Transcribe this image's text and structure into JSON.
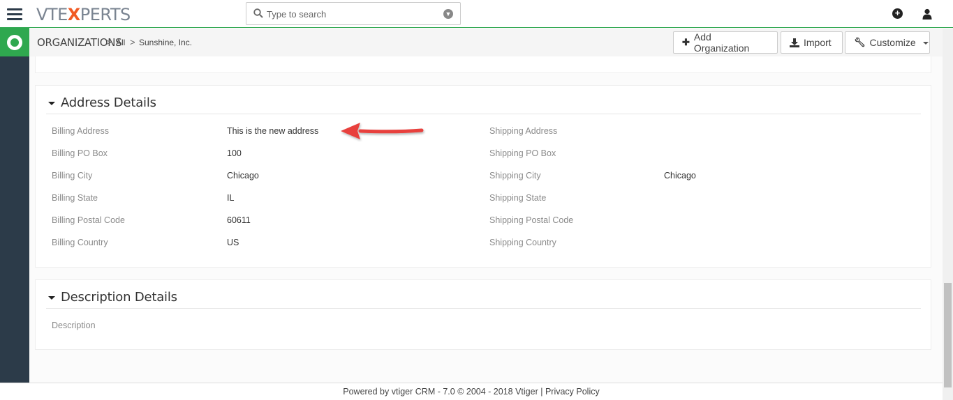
{
  "header": {
    "logo_left": "VTE",
    "logo_x": "X",
    "logo_right": "PERTS",
    "search_placeholder": "Type to search"
  },
  "module": {
    "name": "ORGANIZATIONS",
    "breadcrumb_all": "All",
    "breadcrumb_record": "Sunshine, Inc."
  },
  "actions": {
    "add": "Add Organization",
    "import": "Import",
    "customize": "Customize"
  },
  "address_block": {
    "title": "Address Details",
    "billing": [
      {
        "label": "Billing Address",
        "value": "This is the new address"
      },
      {
        "label": "Billing PO Box",
        "value": "100"
      },
      {
        "label": "Billing City",
        "value": "Chicago"
      },
      {
        "label": "Billing State",
        "value": "IL"
      },
      {
        "label": "Billing Postal Code",
        "value": "60611"
      },
      {
        "label": "Billing Country",
        "value": "US"
      }
    ],
    "shipping": [
      {
        "label": "Shipping Address",
        "value": ""
      },
      {
        "label": "Shipping PO Box",
        "value": ""
      },
      {
        "label": "Shipping City",
        "value": "Chicago"
      },
      {
        "label": "Shipping State",
        "value": ""
      },
      {
        "label": "Shipping Postal Code",
        "value": ""
      },
      {
        "label": "Shipping Country",
        "value": ""
      }
    ]
  },
  "description_block": {
    "title": "Description Details",
    "label": "Description",
    "value": ""
  },
  "footer": {
    "powered": "Powered by vtiger CRM - 7.0  © 2004 - 2018 ",
    "vtiger": "Vtiger",
    "sep": " | ",
    "privacy": "Privacy Policy"
  },
  "colors": {
    "accent": "#2fa84f",
    "nav": "#2c3b49",
    "arrow": "#e8413c",
    "logo_x": "#f15a24"
  }
}
